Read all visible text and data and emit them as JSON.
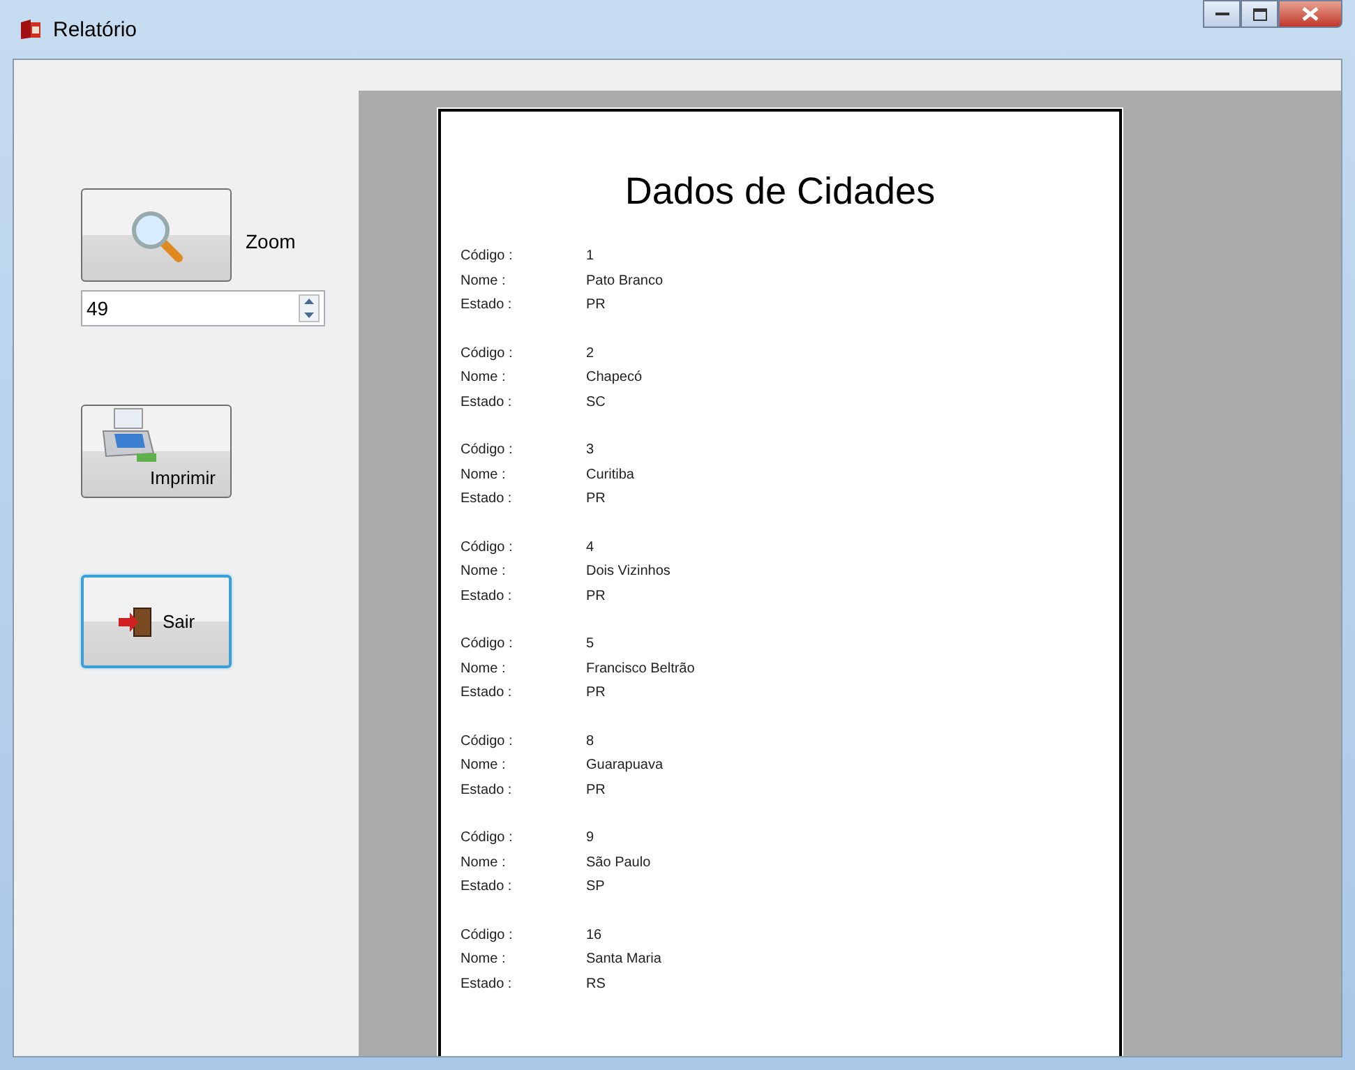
{
  "window": {
    "title": "Relatório"
  },
  "zoom_button": {
    "label": "Zoom"
  },
  "zoom_field": {
    "value": "49"
  },
  "buttons": [
    {
      "kind": "print",
      "label": "Imprimir",
      "focused": false
    },
    {
      "kind": "exit",
      "label": "Sair",
      "focused": true
    }
  ],
  "report": {
    "title": "Dados de Cidades",
    "records": [
      {
        "fields": [
          {
            "label": "Código :",
            "value": "1"
          },
          {
            "label": "Nome :",
            "value": "Pato Branco"
          },
          {
            "label": "Estado :",
            "value": "PR"
          }
        ]
      },
      {
        "fields": [
          {
            "label": "Código :",
            "value": "2"
          },
          {
            "label": "Nome :",
            "value": "Chapecó"
          },
          {
            "label": "Estado :",
            "value": "SC"
          }
        ]
      },
      {
        "fields": [
          {
            "label": "Código :",
            "value": "3"
          },
          {
            "label": "Nome :",
            "value": "Curitiba"
          },
          {
            "label": "Estado :",
            "value": "PR"
          }
        ]
      },
      {
        "fields": [
          {
            "label": "Código :",
            "value": "4"
          },
          {
            "label": "Nome :",
            "value": "Dois Vizinhos"
          },
          {
            "label": "Estado :",
            "value": "PR"
          }
        ]
      },
      {
        "fields": [
          {
            "label": "Código :",
            "value": "5"
          },
          {
            "label": "Nome :",
            "value": "Francisco Beltrão"
          },
          {
            "label": "Estado :",
            "value": "PR"
          }
        ]
      },
      {
        "fields": [
          {
            "label": "Código :",
            "value": "8"
          },
          {
            "label": "Nome :",
            "value": "Guarapuava"
          },
          {
            "label": "Estado :",
            "value": "PR"
          }
        ]
      },
      {
        "fields": [
          {
            "label": "Código :",
            "value": "9"
          },
          {
            "label": "Nome :",
            "value": "São Paulo"
          },
          {
            "label": "Estado :",
            "value": "SP"
          }
        ]
      },
      {
        "fields": [
          {
            "label": "Código :",
            "value": "16"
          },
          {
            "label": "Nome :",
            "value": "Santa Maria"
          },
          {
            "label": "Estado :",
            "value": "RS"
          }
        ]
      }
    ]
  }
}
